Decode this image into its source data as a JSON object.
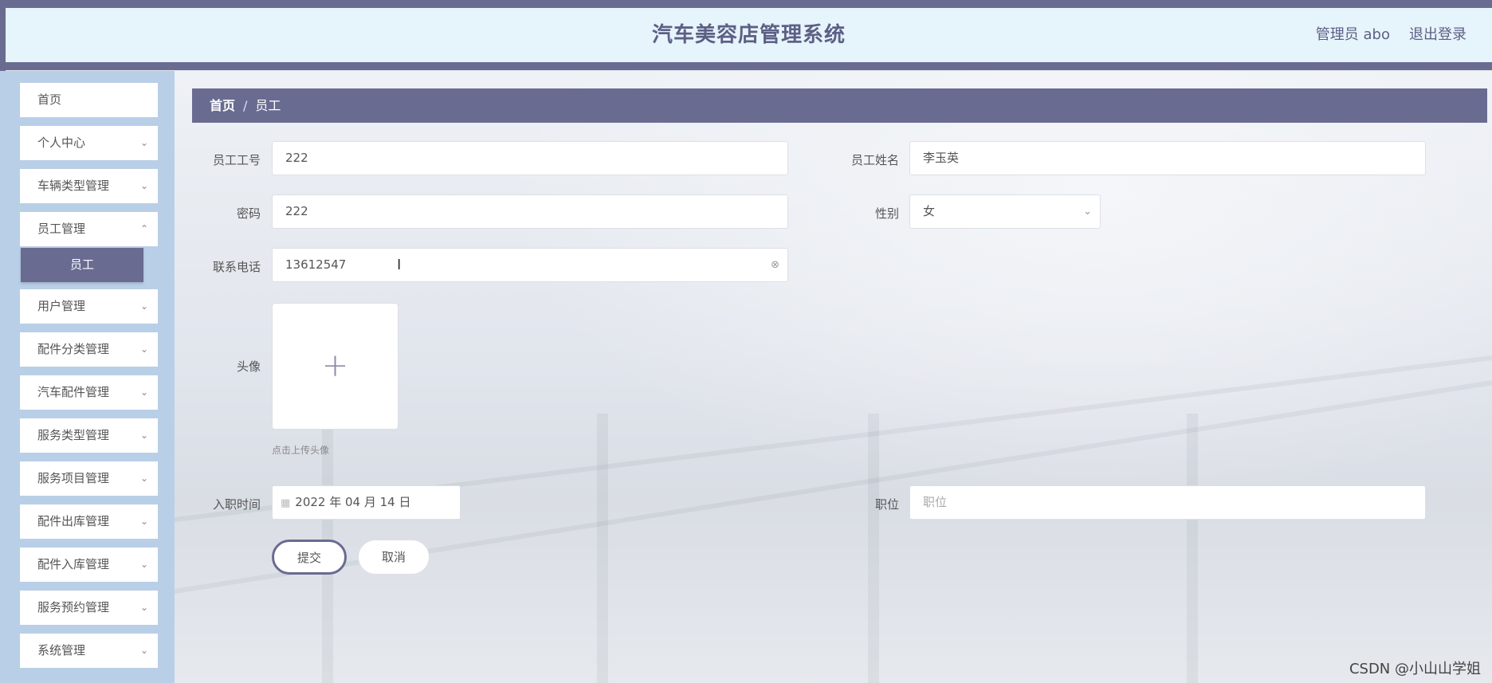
{
  "header": {
    "title": "汽车美容店管理系统",
    "admin_label": "管理员 abo",
    "logout_label": "退出登录"
  },
  "sidebar": {
    "items": [
      {
        "label": "首页",
        "has_chevron": false
      },
      {
        "label": "个人中心",
        "has_chevron": true
      },
      {
        "label": "车辆类型管理",
        "has_chevron": true
      },
      {
        "label": "员工管理",
        "has_chevron": true
      },
      {
        "label": "用户管理",
        "has_chevron": true
      },
      {
        "label": "配件分类管理",
        "has_chevron": true
      },
      {
        "label": "汽车配件管理",
        "has_chevron": true
      },
      {
        "label": "服务类型管理",
        "has_chevron": true
      },
      {
        "label": "服务项目管理",
        "has_chevron": true
      },
      {
        "label": "配件出库管理",
        "has_chevron": true
      },
      {
        "label": "配件入库管理",
        "has_chevron": true
      },
      {
        "label": "服务预约管理",
        "has_chevron": true
      },
      {
        "label": "系统管理",
        "has_chevron": true
      }
    ],
    "active_subitem": "员工"
  },
  "breadcrumb": {
    "home": "首页",
    "separator": "/",
    "current": "员工"
  },
  "form": {
    "employee_id": {
      "label": "员工工号",
      "value": "222"
    },
    "employee_name": {
      "label": "员工姓名",
      "value": "李玉英"
    },
    "password": {
      "label": "密码",
      "value": "222"
    },
    "gender": {
      "label": "性别",
      "value": "女"
    },
    "phone": {
      "label": "联系电话",
      "value": "13612547"
    },
    "avatar": {
      "label": "头像",
      "hint": "点击上传头像"
    },
    "hire_date": {
      "label": "入职时间",
      "value": "2022 年 04 月 14 日"
    },
    "position": {
      "label": "职位",
      "placeholder": "职位",
      "value": ""
    },
    "submit_label": "提交",
    "cancel_label": "取消"
  },
  "watermark": "CSDN @小山山学姐",
  "colors": {
    "primary": "#6a6b91",
    "header_bg": "#e6f4fb",
    "sidebar_bg": "#b9cfe8"
  }
}
